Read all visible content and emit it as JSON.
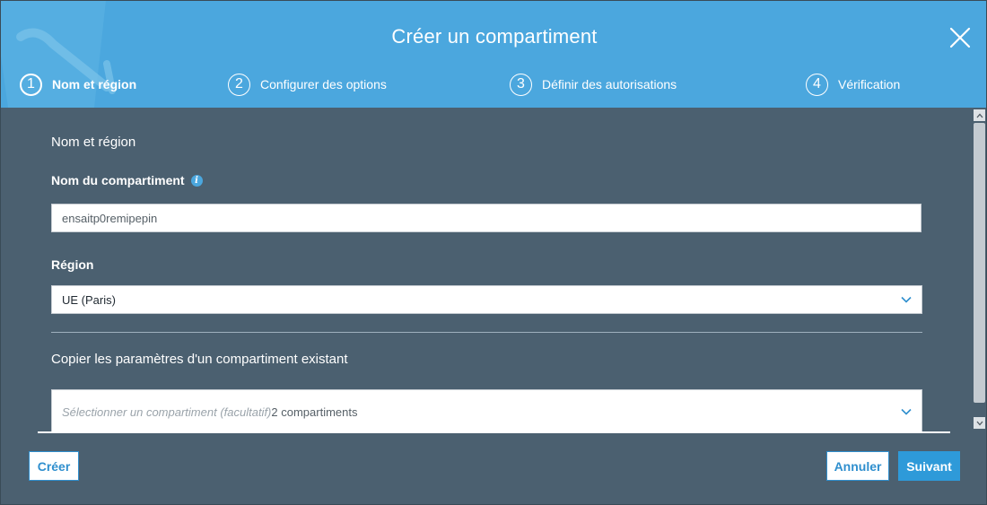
{
  "dialog": {
    "title": "Créer un compartiment"
  },
  "steps": [
    {
      "number": "1",
      "label": "Nom et région",
      "active": true
    },
    {
      "number": "2",
      "label": "Configurer des options",
      "active": false
    },
    {
      "number": "3",
      "label": "Définir des autorisations",
      "active": false
    },
    {
      "number": "4",
      "label": "Vérification",
      "active": false
    }
  ],
  "form": {
    "section_title": "Nom et région",
    "bucket_name_label": "Nom du compartiment",
    "bucket_name_value": "ensaitp0remipepin",
    "region_label": "Région",
    "region_value": "UE (Paris)",
    "copy_title": "Copier les paramètres d'un compartiment existant",
    "copy_placeholder": "Sélectionner un compartiment (facultatif)",
    "copy_count": "2 compartiments"
  },
  "footer": {
    "create_label": "Créer",
    "cancel_label": "Annuler",
    "next_label": "Suivant"
  },
  "icons": {
    "close": "close-icon",
    "info": "info-icon",
    "dropdown": "chevron-down-icon"
  },
  "colors": {
    "header": "#4ba7de",
    "body": "#4b6070",
    "primary_button": "#2e9ad9",
    "info_icon": "#4ba7de"
  }
}
